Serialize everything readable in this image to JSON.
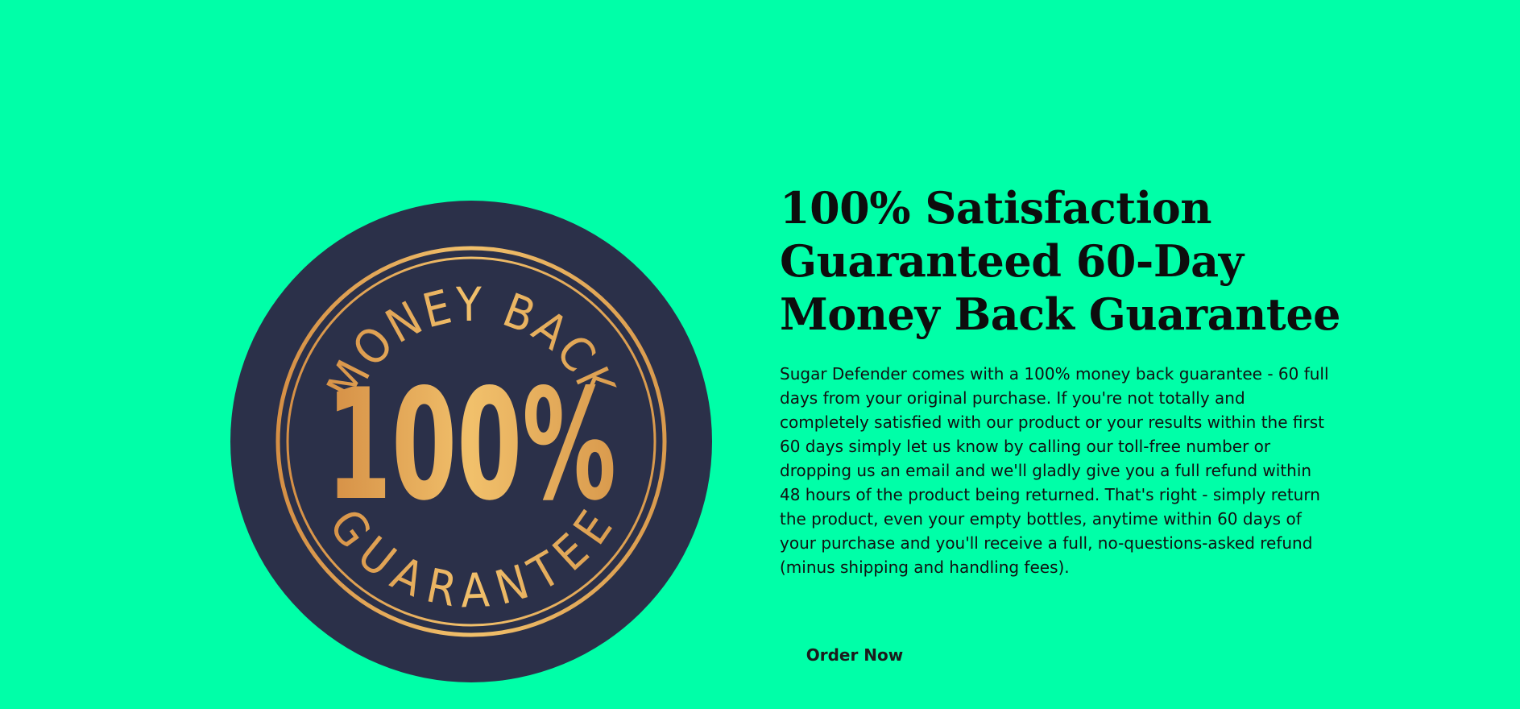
{
  "colors": {
    "background": "#00ffa8",
    "badge_fill": "#2b3049",
    "badge_gold": "#e2a85a",
    "text": "#111111"
  },
  "badge": {
    "icon": "money-back-guarantee-seal",
    "top_text": "MONEY BACK",
    "center_text": "100%",
    "bottom_text": "GUARANTEE"
  },
  "guarantee": {
    "headline_lines": [
      "100% Satisfaction",
      "Guaranteed 60-Day",
      "Money Back Guarantee"
    ],
    "body": "Sugar Defender comes with a 100% money back guarantee - 60 full days from your original purchase. If you're not totally and completely satisfied with our product or your results within the first 60 days simply let us know by calling our toll-free number or dropping us an email and we'll gladly give you a full refund within 48 hours of the product being returned. That's right - simply return the product, even your empty bottles, anytime within 60 days of your purchase and you'll receive a full, no-questions-asked refund (minus shipping and handling fees).",
    "cta_label": "Order Now"
  }
}
